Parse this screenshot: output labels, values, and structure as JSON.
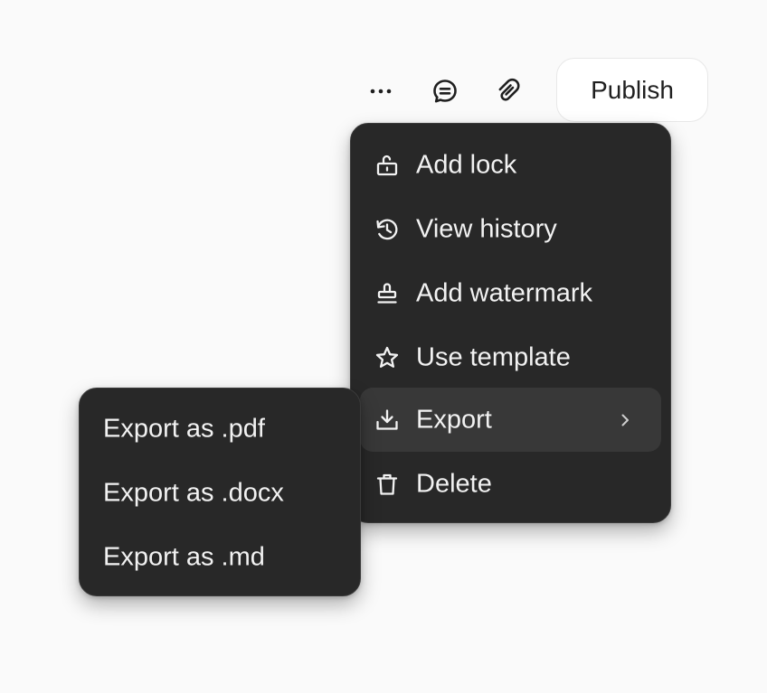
{
  "toolbar": {
    "more_icon": "more-horizontal-icon",
    "comment_icon": "comment-icon",
    "link_icon": "link-icon",
    "publish_label": "Publish"
  },
  "menu": {
    "items": [
      {
        "label": "Add lock",
        "icon": "lock-icon"
      },
      {
        "label": "View history",
        "icon": "history-icon"
      },
      {
        "label": "Add watermark",
        "icon": "stamp-icon"
      },
      {
        "label": "Use template",
        "icon": "star-icon"
      },
      {
        "label": "Export",
        "icon": "download-icon",
        "active": true,
        "has_submenu": true
      },
      {
        "label": "Delete",
        "icon": "trash-icon"
      }
    ]
  },
  "export_submenu": {
    "items": [
      {
        "label": "Export as .pdf"
      },
      {
        "label": "Export as .docx"
      },
      {
        "label": "Export as .md"
      }
    ]
  },
  "colors": {
    "page_background": "#fafafa",
    "menu_background": "#282828",
    "menu_active_background": "#383838",
    "menu_text": "#f2f2f2",
    "publish_background": "#ffffff"
  }
}
